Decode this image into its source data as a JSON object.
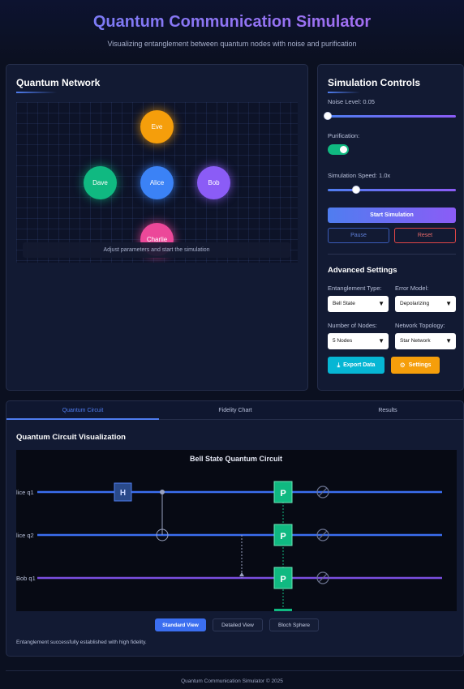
{
  "header": {
    "title": "Quantum Communication Simulator",
    "subtitle": "Visualizing entanglement between quantum nodes with noise and purification"
  },
  "network": {
    "title": "Quantum Network",
    "nodes": [
      {
        "label": "Eve",
        "color": "#f59e0b"
      },
      {
        "label": "Dave",
        "color": "#10b981"
      },
      {
        "label": "Alice",
        "color": "#3b82f6"
      },
      {
        "label": "Bob",
        "color": "#8b5cf6"
      },
      {
        "label": "Charlie",
        "color": "#ec4899"
      }
    ],
    "status": "Adjust parameters and start the simulation"
  },
  "controls": {
    "title": "Simulation Controls",
    "noise_label": "Noise Level: 0.05",
    "noise_value": 0.05,
    "purification_label": "Purification:",
    "purification_on": true,
    "speed_label": "Simulation Speed: 1.0x",
    "speed_value": 1.0,
    "start_label": "Start Simulation",
    "pause_label": "Pause",
    "reset_label": "Reset"
  },
  "advanced": {
    "title": "Advanced Settings",
    "entanglement_type_label": "Entanglement Type:",
    "entanglement_type_value": "Bell State",
    "error_model_label": "Error Model:",
    "error_model_value": "Depolarizing",
    "num_nodes_label": "Number of Nodes:",
    "num_nodes_value": "5 Nodes",
    "topology_label": "Network Topology:",
    "topology_value": "Star Network",
    "export_label": "Export Data",
    "settings_label": "Settings"
  },
  "tabs": [
    {
      "label": "Quantum Circuit",
      "active": true
    },
    {
      "label": "Fidelity Chart",
      "active": false
    },
    {
      "label": "Results",
      "active": false
    }
  ],
  "circuit": {
    "title": "Quantum Circuit Visualization",
    "canvas_title": "Bell State Quantum Circuit",
    "qubits": [
      "lice q1",
      "lice q2",
      "Bob q1"
    ],
    "gate_h": "H",
    "gate_p": "P",
    "views": [
      {
        "label": "Standard View",
        "active": true
      },
      {
        "label": "Detailed View",
        "active": false
      },
      {
        "label": "Bloch Sphere",
        "active": false
      }
    ],
    "status": "Entanglement successfully established with high fidelity."
  },
  "footer": {
    "text": "Quantum Communication Simulator © 2025"
  },
  "colors": {
    "accent": "#4f7df0",
    "purple": "#8b5cf6",
    "success": "#10b981",
    "danger": "#e04646",
    "warning": "#f59e0b",
    "cyan": "#06b6d4"
  }
}
